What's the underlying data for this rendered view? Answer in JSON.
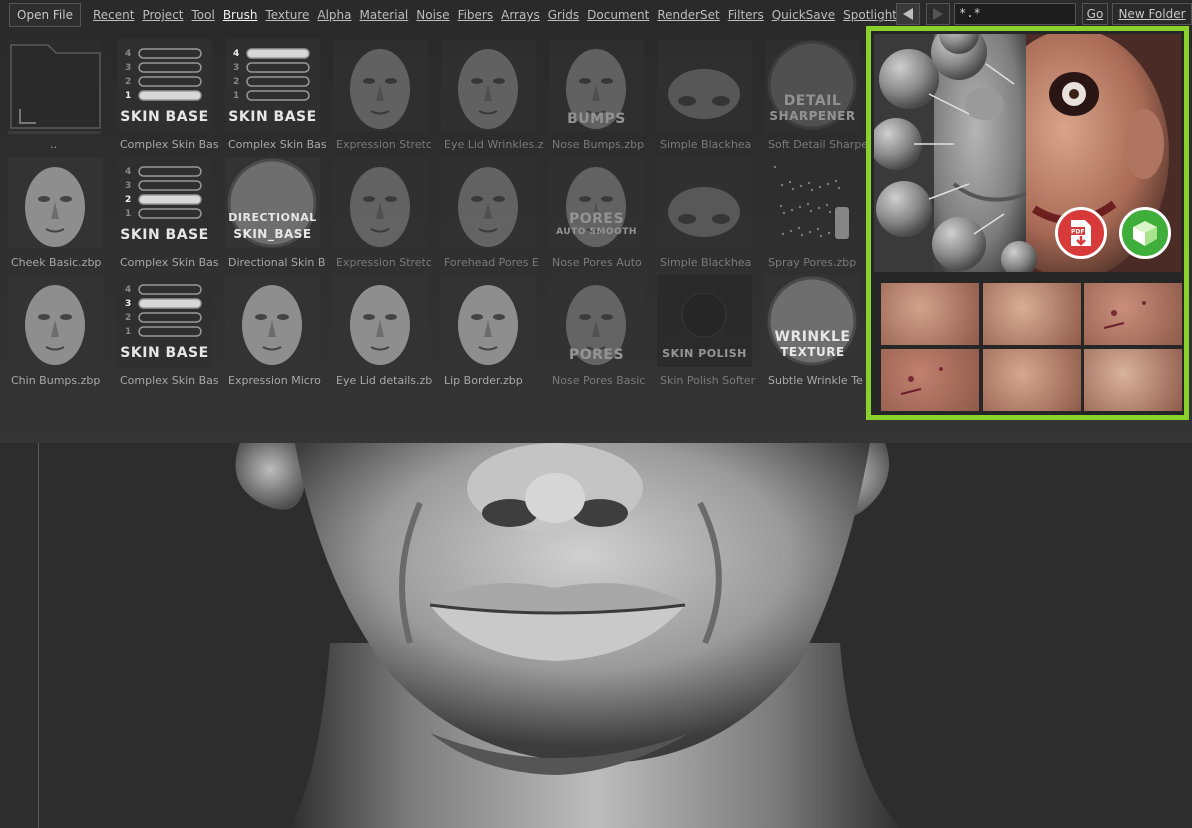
{
  "menubar": {
    "open_file": "Open File",
    "items": [
      "Recent",
      "Project",
      "Tool",
      "Brush",
      "Texture",
      "Alpha",
      "Material",
      "Noise",
      "Fibers",
      "Arrays",
      "Grids",
      "Document",
      "RenderSet",
      "Filters",
      "QuickSave",
      "Spotlight"
    ],
    "active": "Brush",
    "filter_value": "*.*",
    "go_label": "Go",
    "new_folder_label": "New Folder"
  },
  "browser": {
    "tiles": [
      {
        "label": "..",
        "kind": "folder",
        "dim": false
      },
      {
        "label": "Complex Skin Bas",
        "kind": "skinbase",
        "badge": "SKIN BASE",
        "level": 1,
        "dim": false
      },
      {
        "label": "Complex Skin Bas",
        "kind": "skinbase",
        "badge": "SKIN BASE",
        "level": 4,
        "dim": false
      },
      {
        "label": "Expression Stretc",
        "kind": "face",
        "dim": true
      },
      {
        "label": "Eye Lid Wrinkles.z",
        "kind": "face",
        "dim": true
      },
      {
        "label": "Nose Bumps.zbp",
        "kind": "face",
        "badge": "BUMPS",
        "dim": true
      },
      {
        "label": "Simple Blackhea",
        "kind": "nose",
        "dim": true
      },
      {
        "label": "Soft Detail Sharpe",
        "kind": "sphere",
        "badge": "DETAIL",
        "badge2": "SHARPENER",
        "dim": true
      },
      {
        "label": "Cheek Basic.zbp",
        "kind": "face",
        "dim": false
      },
      {
        "label": "Complex Skin Bas",
        "kind": "skinbase",
        "badge": "SKIN BASE",
        "level": 2,
        "dim": false
      },
      {
        "label": "Directional Skin B",
        "kind": "sphere",
        "badge": "DIRECTIONAL",
        "badge2": "SKIN_BASE",
        "dim": false
      },
      {
        "label": "Expression Stretc",
        "kind": "face",
        "dim": true
      },
      {
        "label": "Forehead Pores E",
        "kind": "face",
        "dim": true
      },
      {
        "label": "Nose Pores Auto",
        "kind": "face",
        "badge": "PORES",
        "badge2": "AUTO SMOOTH",
        "dim": true
      },
      {
        "label": "Simple Blackhea",
        "kind": "nose",
        "dim": true
      },
      {
        "label": "Spray Pores.zbp",
        "kind": "spray",
        "dim": true
      },
      {
        "label": "Chin Bumps.zbp",
        "kind": "face",
        "dim": false
      },
      {
        "label": "Complex Skin Bas",
        "kind": "skinbase",
        "badge": "SKIN BASE",
        "level": 3,
        "dim": false
      },
      {
        "label": "Expression Micro",
        "kind": "face",
        "dim": false
      },
      {
        "label": "Eye Lid details.zb",
        "kind": "face",
        "dim": false
      },
      {
        "label": "Lip Border.zbp",
        "kind": "face",
        "dim": false
      },
      {
        "label": "Nose Pores Basic",
        "kind": "face",
        "badge": "PORES",
        "dim": true
      },
      {
        "label": "Skin Polish Softer",
        "kind": "dark",
        "badge": "SKIN POLISH",
        "dim": true
      },
      {
        "label": "Subtle Wrinkle Te",
        "kind": "sphere",
        "badge": "WRINKLE",
        "badge2": "TEXTURE",
        "dim": false
      }
    ]
  },
  "preview": {
    "accent": "#8bd12c",
    "pdf_button_color": "#d83a3a",
    "model_button_color": "#3fae3a",
    "pdf_label": "PDF"
  }
}
